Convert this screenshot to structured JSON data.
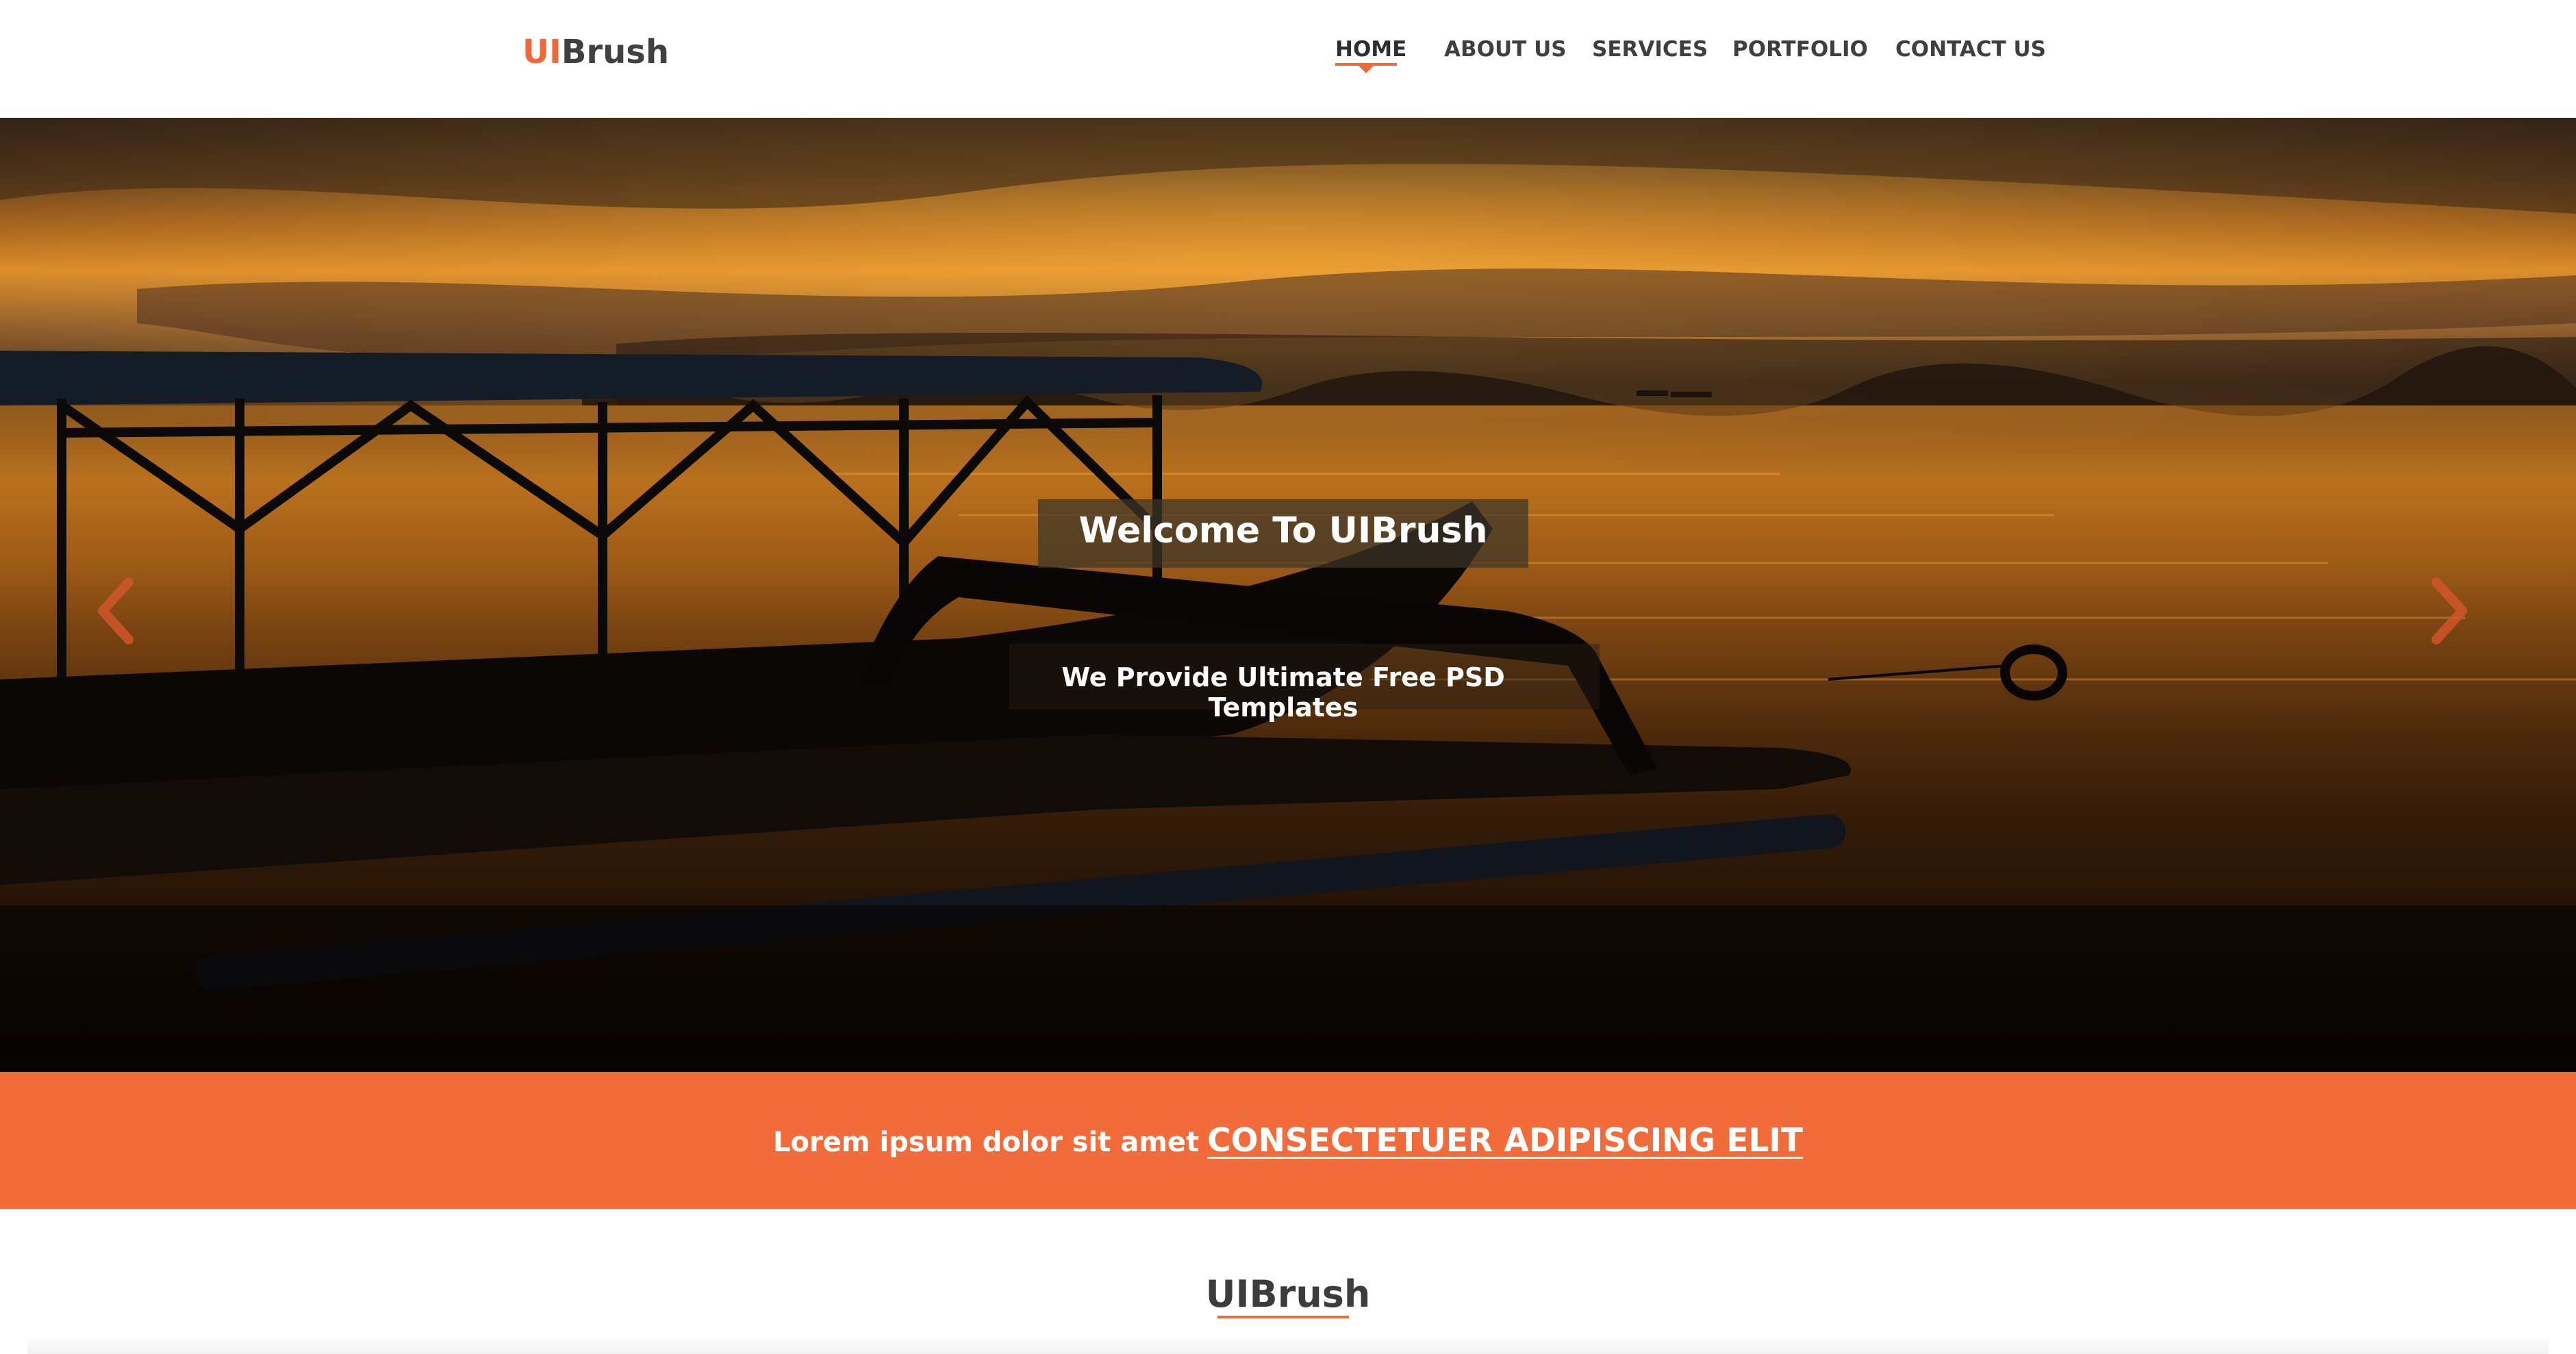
{
  "header": {
    "logo_accent": "UI",
    "logo_rest": "Brush",
    "nav": [
      {
        "label": "HOME",
        "active": true
      },
      {
        "label": "ABOUT US",
        "active": false
      },
      {
        "label": "SERVICES",
        "active": false
      },
      {
        "label": "PORTFOLIO",
        "active": false
      },
      {
        "label": "CONTACT US",
        "active": false
      }
    ]
  },
  "hero": {
    "title": "Welcome To UIBrush",
    "subtitle": "We Provide Ultimate Free PSD Templates",
    "prev_icon": "chevron-left-icon",
    "next_icon": "chevron-right-icon"
  },
  "banner": {
    "text": "Lorem ipsum dolor sit amet",
    "link": "CONSECTETUER ADIPISCING ELIT"
  },
  "section": {
    "title": "UIBrush"
  },
  "colors": {
    "accent": "#f26b3b",
    "text_dark": "#3c3c3c",
    "white": "#ffffff"
  }
}
